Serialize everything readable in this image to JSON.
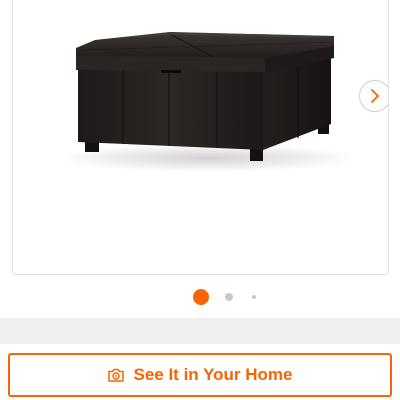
{
  "product_gallery": {
    "image_subject": "square-storage-ottoman",
    "next_icon": "chevron-right-icon",
    "pagination": {
      "total": 3,
      "active": 1
    }
  },
  "cta": {
    "label": "See It in Your Home",
    "icon": "camera-ar-icon"
  },
  "colors": {
    "accent": "#f96302",
    "dot_inactive": "#c8c8c8",
    "band": "#efefef",
    "ottoman": "#2a2523"
  }
}
